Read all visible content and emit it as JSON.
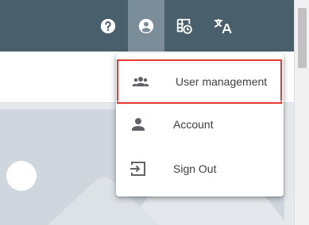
{
  "toolbar": {
    "buttons": [
      {
        "icon": "help-icon"
      },
      {
        "icon": "account-icon",
        "active": true
      },
      {
        "icon": "schedule-table-icon"
      },
      {
        "icon": "translate-icon"
      }
    ]
  },
  "account_menu": {
    "items": [
      {
        "icon": "group-icon",
        "label": "User management",
        "highlighted": true
      },
      {
        "icon": "person-icon",
        "label": "Account"
      },
      {
        "icon": "sign-out-icon",
        "label": "Sign Out"
      }
    ]
  },
  "colors": {
    "topbar": "#4a5f6c",
    "active_button": "#7b8d99",
    "highlight_border": "#e53935",
    "menu_icon": "#5f6368"
  }
}
